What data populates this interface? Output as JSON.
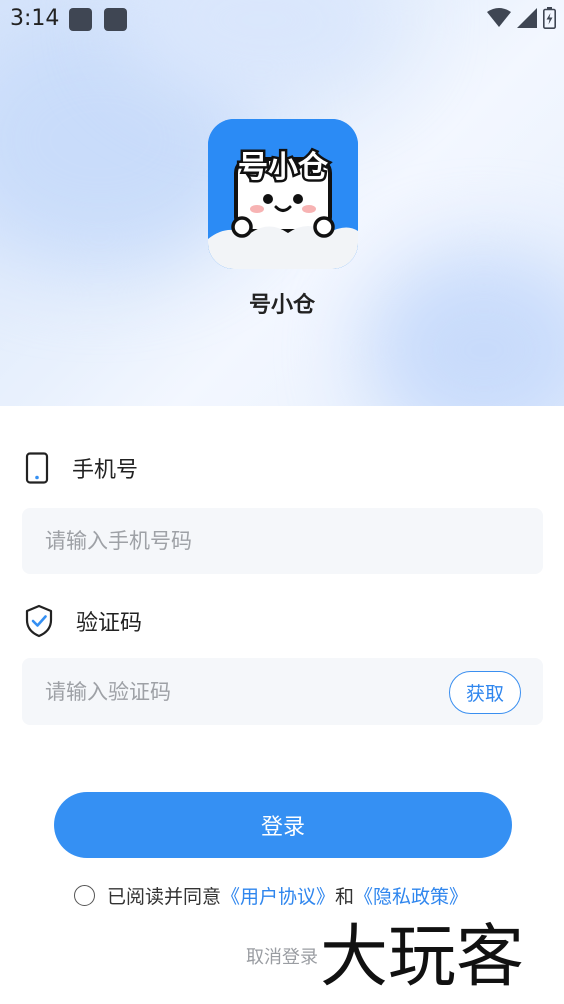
{
  "status_bar": {
    "time": "3:14"
  },
  "app": {
    "name": "号小仓",
    "icon_text": "号小仓"
  },
  "phone": {
    "label": "手机号",
    "placeholder": "请输入手机号码"
  },
  "code": {
    "label": "验证码",
    "placeholder": "请输入验证码",
    "get_label": "获取"
  },
  "login_label": "登录",
  "agreement": {
    "prefix": "已阅读并同意",
    "user_agreement": "《用户协议》",
    "and": "和",
    "privacy_policy": "《隐私政策》"
  },
  "cancel_label": "取消登录",
  "watermark": "大玩客",
  "colors": {
    "accent": "#3590f3",
    "link": "#2f86ee",
    "field_bg": "#f5f7fa"
  }
}
